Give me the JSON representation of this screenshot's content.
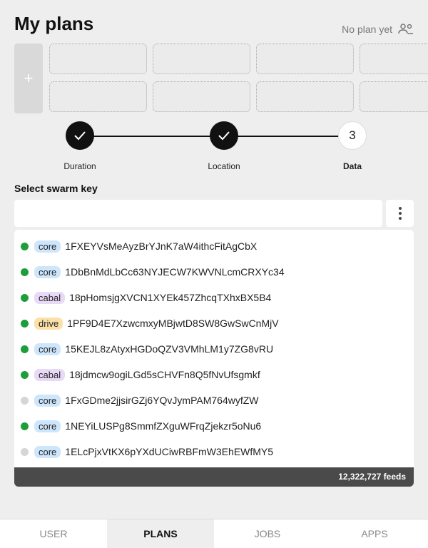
{
  "header": {
    "title": "My plans",
    "plan_status": "No plan yet"
  },
  "slots": {
    "add_label": "+"
  },
  "stepper": {
    "steps": [
      {
        "label": "Duration",
        "state": "done"
      },
      {
        "label": "Location",
        "state": "done"
      },
      {
        "label": "Data",
        "state": "current",
        "number": "3"
      }
    ]
  },
  "swarm": {
    "label": "Select swarm key",
    "input_value": "",
    "placeholder": ""
  },
  "keys": [
    {
      "status": "active",
      "type": "core",
      "key": "1FXEYVsMeAyzBrYJnK7aW4ithcFitAgCbX"
    },
    {
      "status": "active",
      "type": "core",
      "key": "1DbBnMdLbCc63NYJECW7KWVNLcmCRXYc34"
    },
    {
      "status": "active",
      "type": "cabal",
      "key": "18pHomsjgXVCN1XYEk457ZhcqTXhxBX5B4"
    },
    {
      "status": "active",
      "type": "drive",
      "key": "1PF9D4E7XzwcmxyMBjwtD8SW8GwSwCnMjV"
    },
    {
      "status": "active",
      "type": "core",
      "key": "15KEJL8zAtyxHGDoQZV3VMhLM1y7ZG8vRU"
    },
    {
      "status": "active",
      "type": "cabal",
      "key": "18jdmcw9ogiLGd5sCHVFn8Q5fNvUfsgmkf"
    },
    {
      "status": "inactive",
      "type": "core",
      "key": "1FxGDme2jjsirGZj6YQvJymPAM764wyfZW"
    },
    {
      "status": "active",
      "type": "core",
      "key": "1NEYiLUSPg8SmmfZXguWFrqZjekzr5oNu6"
    },
    {
      "status": "inactive",
      "type": "core",
      "key": "1ELcPjxVtKX6pYXdUCiwRBFmW3EhEWfMY5"
    }
  ],
  "feeds_count": "12,322,727 feeds",
  "tabs": [
    {
      "label": "USER",
      "active": false
    },
    {
      "label": "PLANS",
      "active": true
    },
    {
      "label": "JOBS",
      "active": false
    },
    {
      "label": "APPS",
      "active": false
    }
  ],
  "colors": {
    "active_dot": "#1e9e3a",
    "inactive_dot": "#d6d6d6",
    "core_badge": "#cde6fb",
    "cabal_badge": "#e8d9f6",
    "drive_badge": "#fbe0a8"
  }
}
